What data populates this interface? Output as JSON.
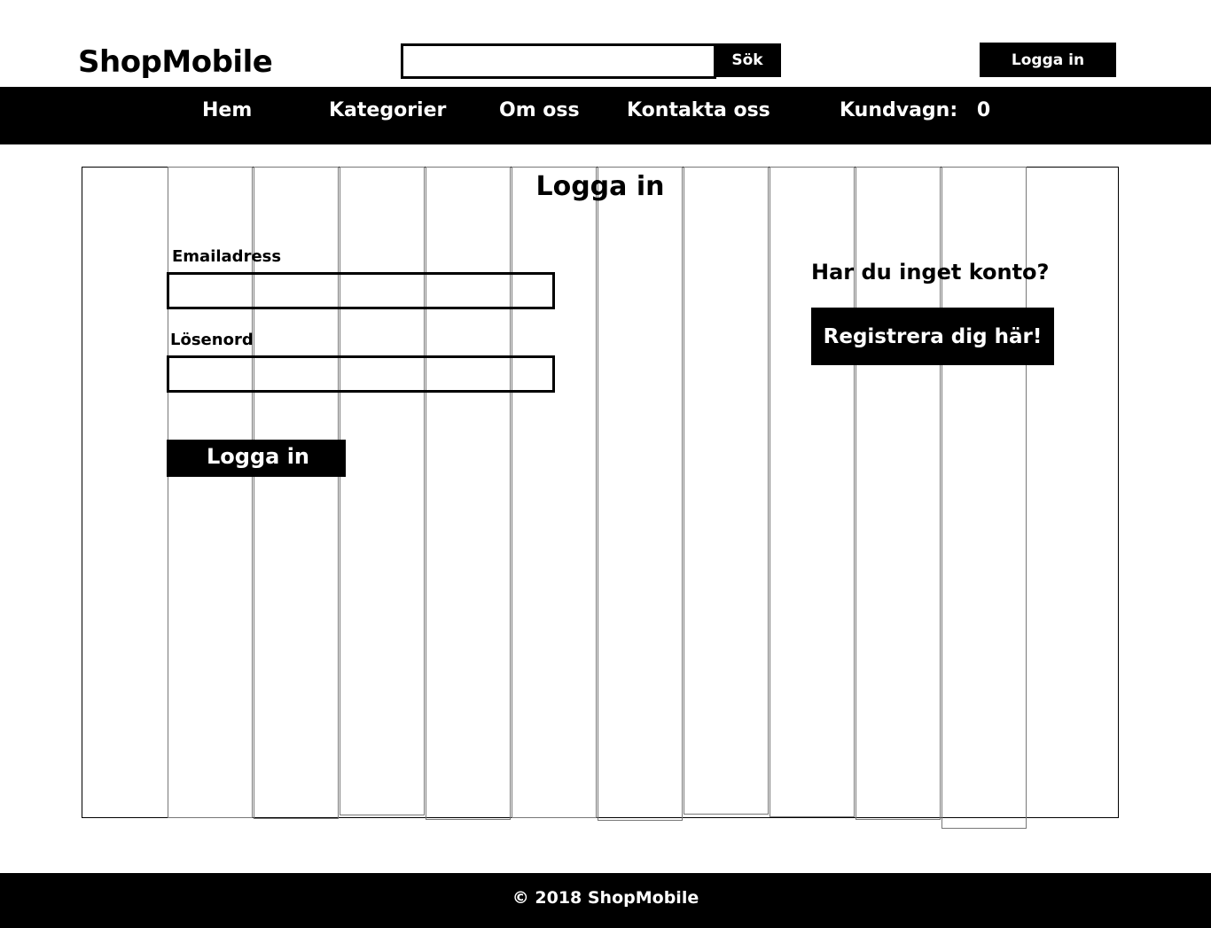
{
  "header": {
    "logo": "ShopMobile",
    "search": {
      "value": "",
      "placeholder": "",
      "button_label": "Sök"
    },
    "login_button": "Logga in"
  },
  "nav": {
    "items": [
      "Hem",
      "Kategorier",
      "Om oss",
      "Kontakta oss"
    ],
    "cart_label": "Kundvagn:",
    "cart_count": "0"
  },
  "login": {
    "title": "Logga in",
    "email_label": "Emailadress",
    "email_value": "",
    "password_label": "Lösenord",
    "password_value": "",
    "submit_label": "Logga in"
  },
  "register": {
    "prompt": "Har du inget konto?",
    "button_label": "Registrera dig här!"
  },
  "footer": {
    "text": "© 2018 ShopMobile"
  },
  "colors": {
    "background": "#ffffff",
    "bar": "#000000",
    "text": "#000000",
    "bar_text": "#ffffff",
    "grid_line": "#777777"
  }
}
